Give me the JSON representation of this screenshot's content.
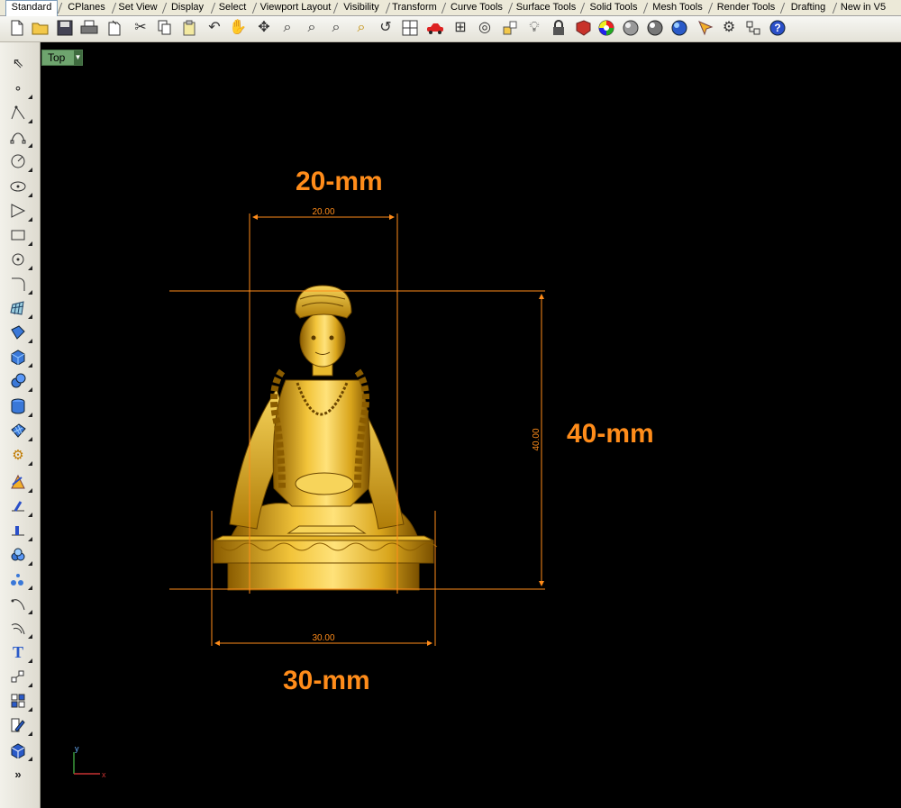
{
  "tabs": [
    "Standard",
    "CPlanes",
    "Set View",
    "Display",
    "Select",
    "Viewport Layout",
    "Visibility",
    "Transform",
    "Curve Tools",
    "Surface Tools",
    "Solid Tools",
    "Mesh Tools",
    "Render Tools",
    "Drafting",
    "New in V5"
  ],
  "toolbar_icons": [
    "new-file-icon",
    "open-folder-icon",
    "save-icon",
    "print-icon",
    "import-icon",
    "cut-icon",
    "copy-icon",
    "paste-icon",
    "undo-icon",
    "pan-hand-icon",
    "rotate-view-icon",
    "zoom-icon",
    "zoom-window-icon",
    "zoom-extents-icon",
    "zoom-selected-icon",
    "undo-view-icon",
    "four-viewports-icon",
    "car-icon",
    "grid-icon",
    "target-icon",
    "cplane-icon",
    "light-bulb-icon",
    "lock-icon",
    "shade-icon",
    "color-wheel-icon",
    "render-sphere-icon",
    "material-sphere-icon",
    "environment-sphere-icon",
    "snap-icon",
    "settings-gear-icon",
    "layers-icon",
    "help-icon"
  ],
  "left_tools": [
    "select-arrow-icon",
    "point-icon",
    "polyline-icon",
    "curve-icon",
    "circle-icon",
    "ellipse-icon",
    "polygon-icon",
    "rectangle-icon",
    "arc-icon",
    "fillet-curve-icon",
    "surface-grid-icon",
    "extrude-surface-icon",
    "box-solid-icon",
    "sphere-solid-icon",
    "cylinder-solid-icon",
    "mesh-icon",
    "transform-gear-icon",
    "explode-icon",
    "split-icon",
    "boolean-icon",
    "analyze-icon",
    "points-cloud-icon",
    "offset-curve-icon",
    "blend-curve-icon",
    "text-icon",
    "array-icon",
    "group-icon",
    "properties-icon",
    "render-cube-icon",
    "more-icon"
  ],
  "viewport": {
    "name": "Top",
    "axis_y": "y",
    "axis_x": "x",
    "dim_width_top": "20.00",
    "dim_height": "40.00",
    "dim_width_bottom": "30.00"
  },
  "annotations": {
    "top": "20-mm",
    "right": "40-mm",
    "bottom": "30-mm"
  },
  "colors": {
    "dimension": "#ff8c1a",
    "statue_gold": "#d9a51c",
    "viewport_bg": "#000000",
    "viewport_tab": "#6ea46e"
  }
}
